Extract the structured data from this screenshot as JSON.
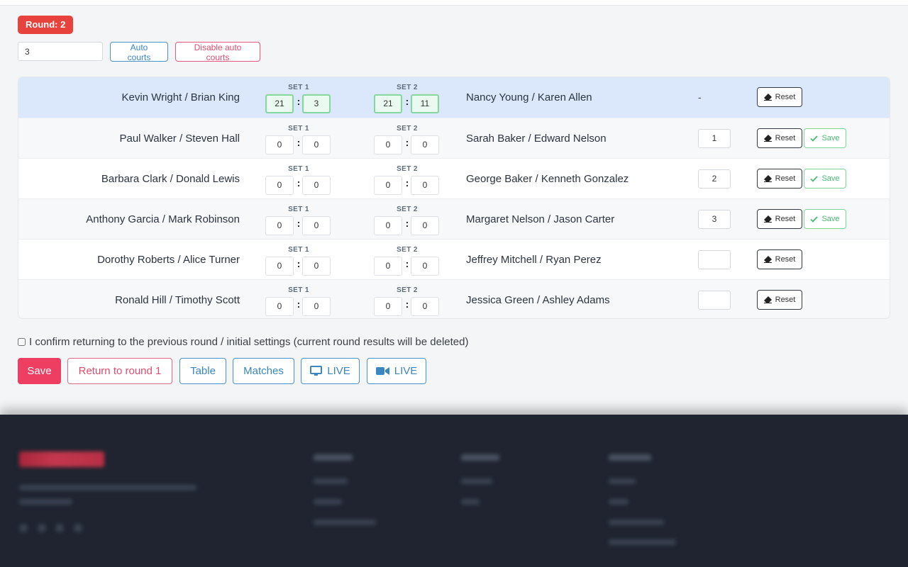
{
  "round_badge": "Round: 2",
  "courts": {
    "value": "3",
    "auto_label": "Auto courts",
    "disable_label": "Disable auto courts"
  },
  "set_labels": {
    "set1": "SET 1",
    "set2": "SET 2"
  },
  "matches": [
    {
      "left": "Kevin Wright / Brian King",
      "right": "Nancy Young / Karen Allen",
      "s1a": "21",
      "s1b": "3",
      "s2a": "21",
      "s2b": "11",
      "court": "-",
      "completed": true
    },
    {
      "left": "Paul Walker / Steven Hall",
      "right": "Sarah Baker / Edward Nelson",
      "s1a": "0",
      "s1b": "0",
      "s2a": "0",
      "s2b": "0",
      "court": "1",
      "completed": false
    },
    {
      "left": "Barbara Clark / Donald Lewis",
      "right": "George Baker / Kenneth Gonzalez",
      "s1a": "0",
      "s1b": "0",
      "s2a": "0",
      "s2b": "0",
      "court": "2",
      "completed": false
    },
    {
      "left": "Anthony Garcia / Mark Robinson",
      "right": "Margaret Nelson / Jason Carter",
      "s1a": "0",
      "s1b": "0",
      "s2a": "0",
      "s2b": "0",
      "court": "3",
      "completed": false
    },
    {
      "left": "Dorothy Roberts / Alice Turner",
      "right": "Jeffrey Mitchell / Ryan Perez",
      "s1a": "0",
      "s1b": "0",
      "s2a": "0",
      "s2b": "0",
      "court": "",
      "completed": false
    },
    {
      "left": "Ronald Hill / Timothy Scott",
      "right": "Jessica Green / Ashley Adams",
      "s1a": "0",
      "s1b": "0",
      "s2a": "0",
      "s2b": "0",
      "court": "",
      "completed": false
    }
  ],
  "row_buttons": {
    "reset": "Reset",
    "save": "Save"
  },
  "confirm_text": "I confirm returning to the previous round / initial settings (current round results will be deleted)",
  "actions": {
    "save": "Save",
    "return": "Return to round 1",
    "table": "Table",
    "matches": "Matches",
    "live_monitor": "LIVE",
    "live_video": "LIVE"
  },
  "icons": {
    "reset": "eraser-icon",
    "save": "check-icon",
    "live_monitor": "monitor-icon",
    "live_video": "video-camera-icon"
  },
  "colors": {
    "badge": "#e8423c",
    "primary_save": "#ee3e62",
    "accent_blue": "#3a86c0",
    "active_row": "#dbe8fb",
    "success": "#49b973",
    "footer": "#1f2430"
  }
}
